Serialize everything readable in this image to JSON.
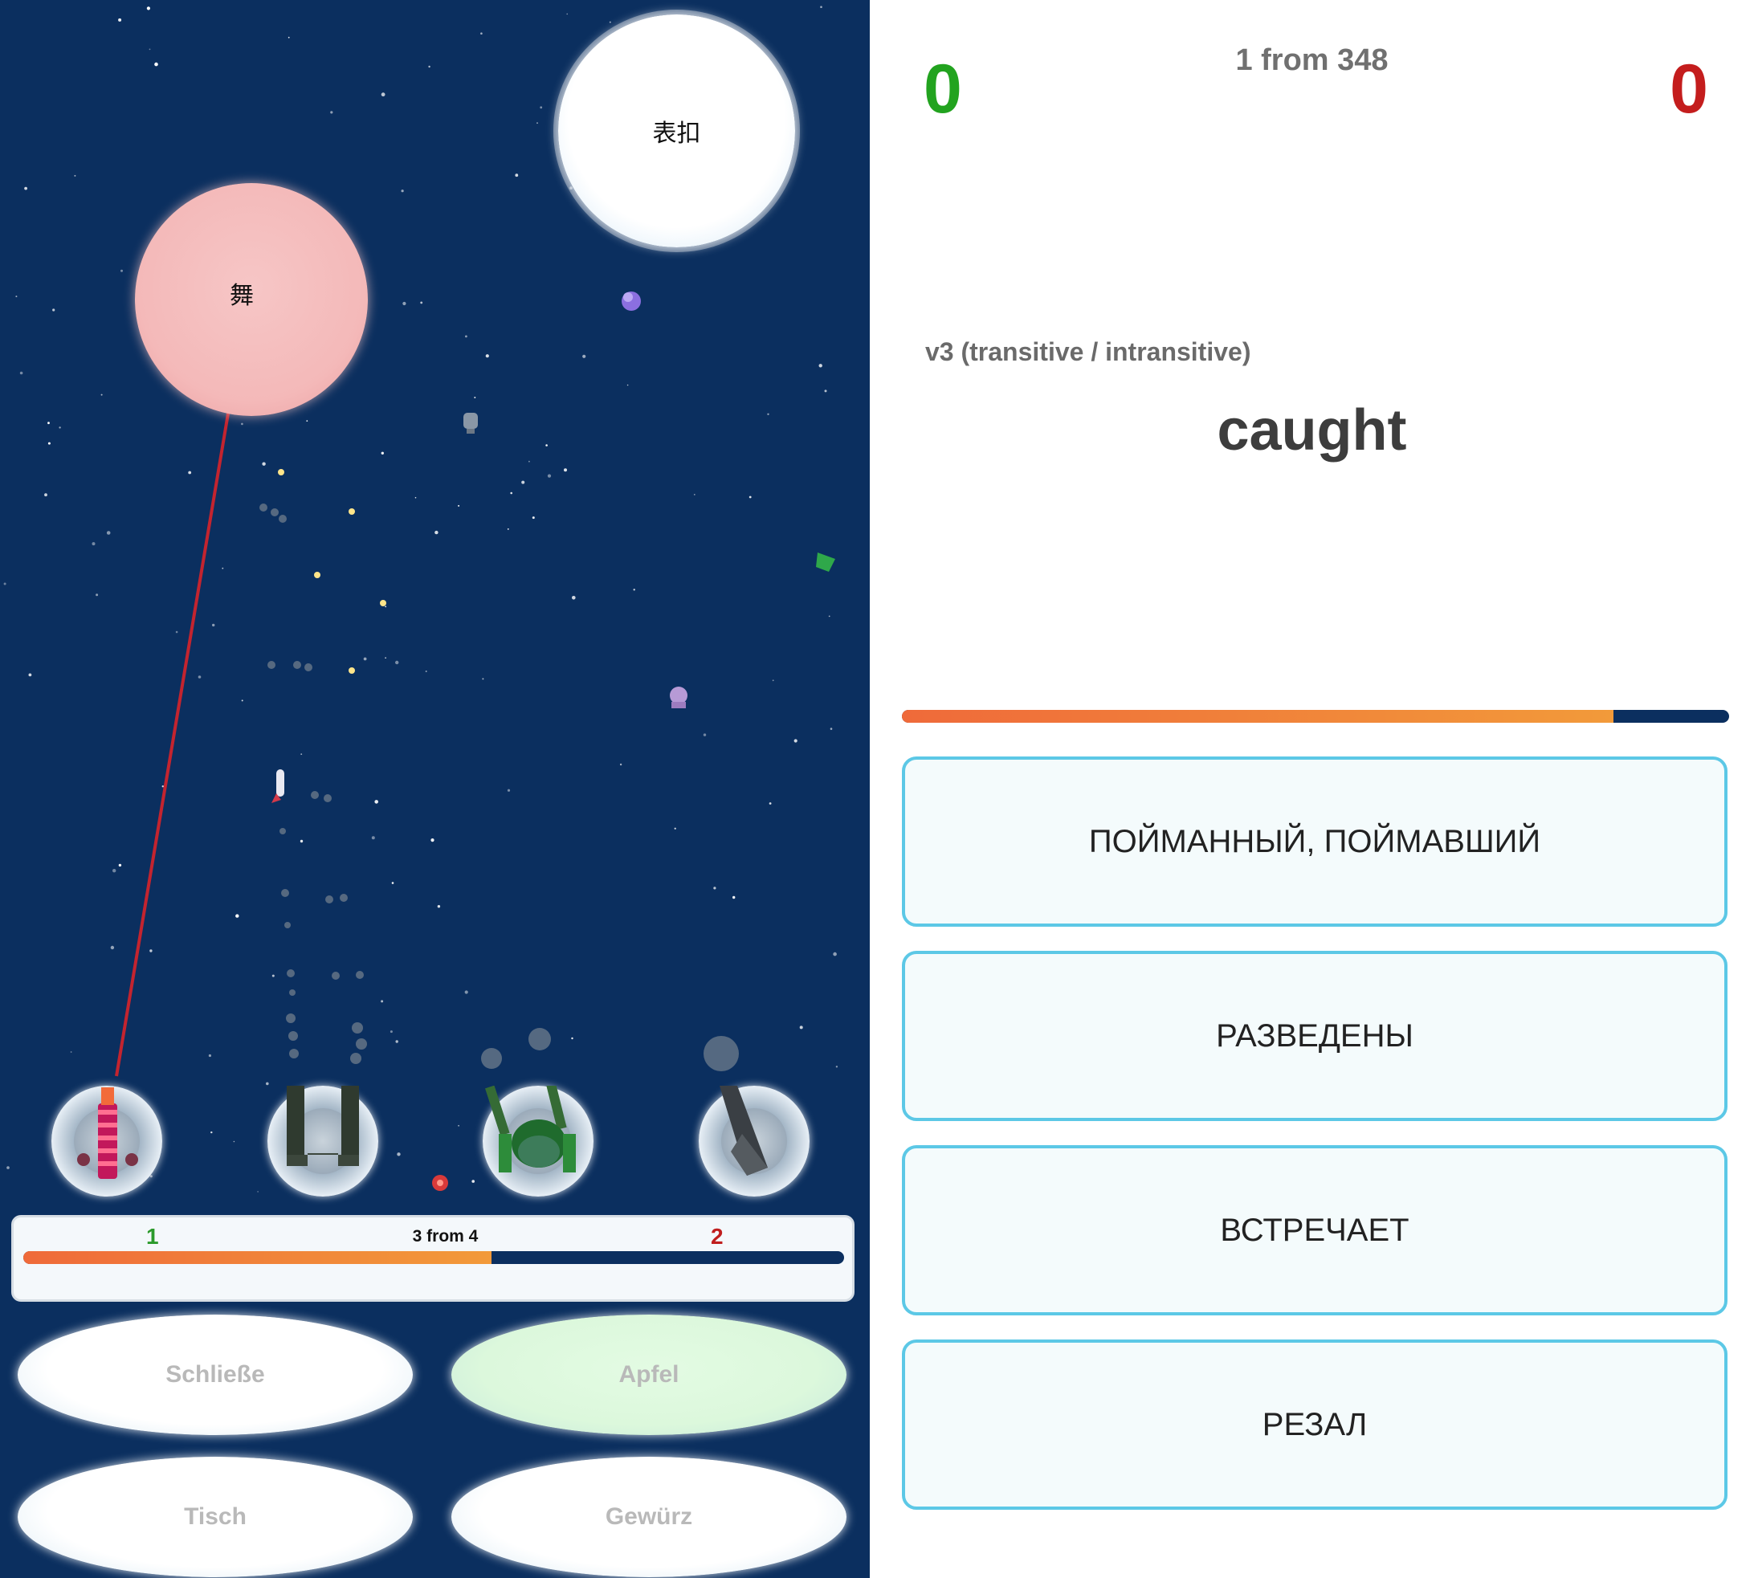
{
  "game": {
    "clouds": {
      "top_word": "表扣",
      "pink_word": "舞"
    },
    "round": {
      "player_score": "1",
      "enemy_score": "2",
      "count_text": "3 from 4",
      "progress_fraction": 0.57
    },
    "answers": [
      {
        "label": "Schließe",
        "highlighted": false
      },
      {
        "label": "Apfel",
        "highlighted": true
      },
      {
        "label": "Tisch",
        "highlighted": false
      },
      {
        "label": "Gewürz",
        "highlighted": false
      }
    ],
    "turrets": [
      "laser-turret-icon",
      "twin-cannon-turret-icon",
      "dome-cannon-turret-icon",
      "mortar-turret-icon"
    ]
  },
  "quiz": {
    "score_correct": "0",
    "score_wrong": "0",
    "count_text": "1 from 348",
    "hint": "v3 (transitive / intransitive)",
    "word": "caught",
    "timer_fraction": 0.86,
    "options": [
      "ПОЙМАННЫЙ, ПОЙМАВШИЙ",
      "РАЗВЕДЕНЫ",
      "ВСТРЕЧАЕТ",
      "РЕЗАЛ"
    ]
  },
  "colors": {
    "space_bg": "#0b2f5f",
    "correct_green": "#22a31f",
    "wrong_red": "#c41d1d",
    "option_border": "#5cc8e6",
    "progress_orange": "#ef6a3a"
  }
}
